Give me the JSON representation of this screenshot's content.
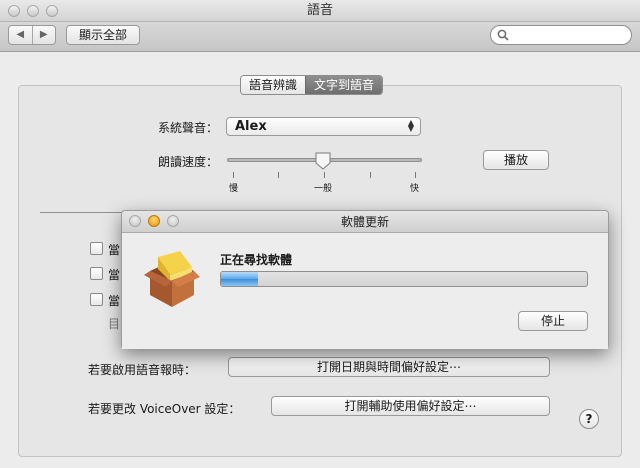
{
  "window": {
    "title": "語音"
  },
  "toolbar": {
    "show_all": "顯示全部",
    "search_placeholder": ""
  },
  "tabs": [
    {
      "label": "語音辨識",
      "active": false
    },
    {
      "label": "文字到語音",
      "active": true
    }
  ],
  "voice": {
    "label": "系統聲音：",
    "value": "Alex"
  },
  "rate": {
    "label": "朗讀速度：",
    "value_percent": 49,
    "slow": "慢",
    "normal": "一般",
    "fast": "快"
  },
  "play_button": "播放",
  "checkboxes": [
    {
      "label": "當",
      "checked": false
    },
    {
      "label": "當",
      "checked": false
    },
    {
      "label": "當",
      "checked": false
    }
  ],
  "checkbox_sub": "目",
  "announce": {
    "label": "若要啟用語音報時：",
    "button": "打開日期與時間偏好設定⋯"
  },
  "voiceover": {
    "label": "若要更改 VoiceOver 設定：",
    "button": "打開輔助使用偏好設定⋯"
  },
  "help": "?",
  "dialog": {
    "title": "軟體更新",
    "status": "正在尋找軟體",
    "progress": 0.1,
    "stop_button": "停止"
  },
  "colors": {
    "progress_blue": "#4a9be2",
    "close_red": "#d63a33",
    "minimize_yellow": "#e8a31d"
  }
}
